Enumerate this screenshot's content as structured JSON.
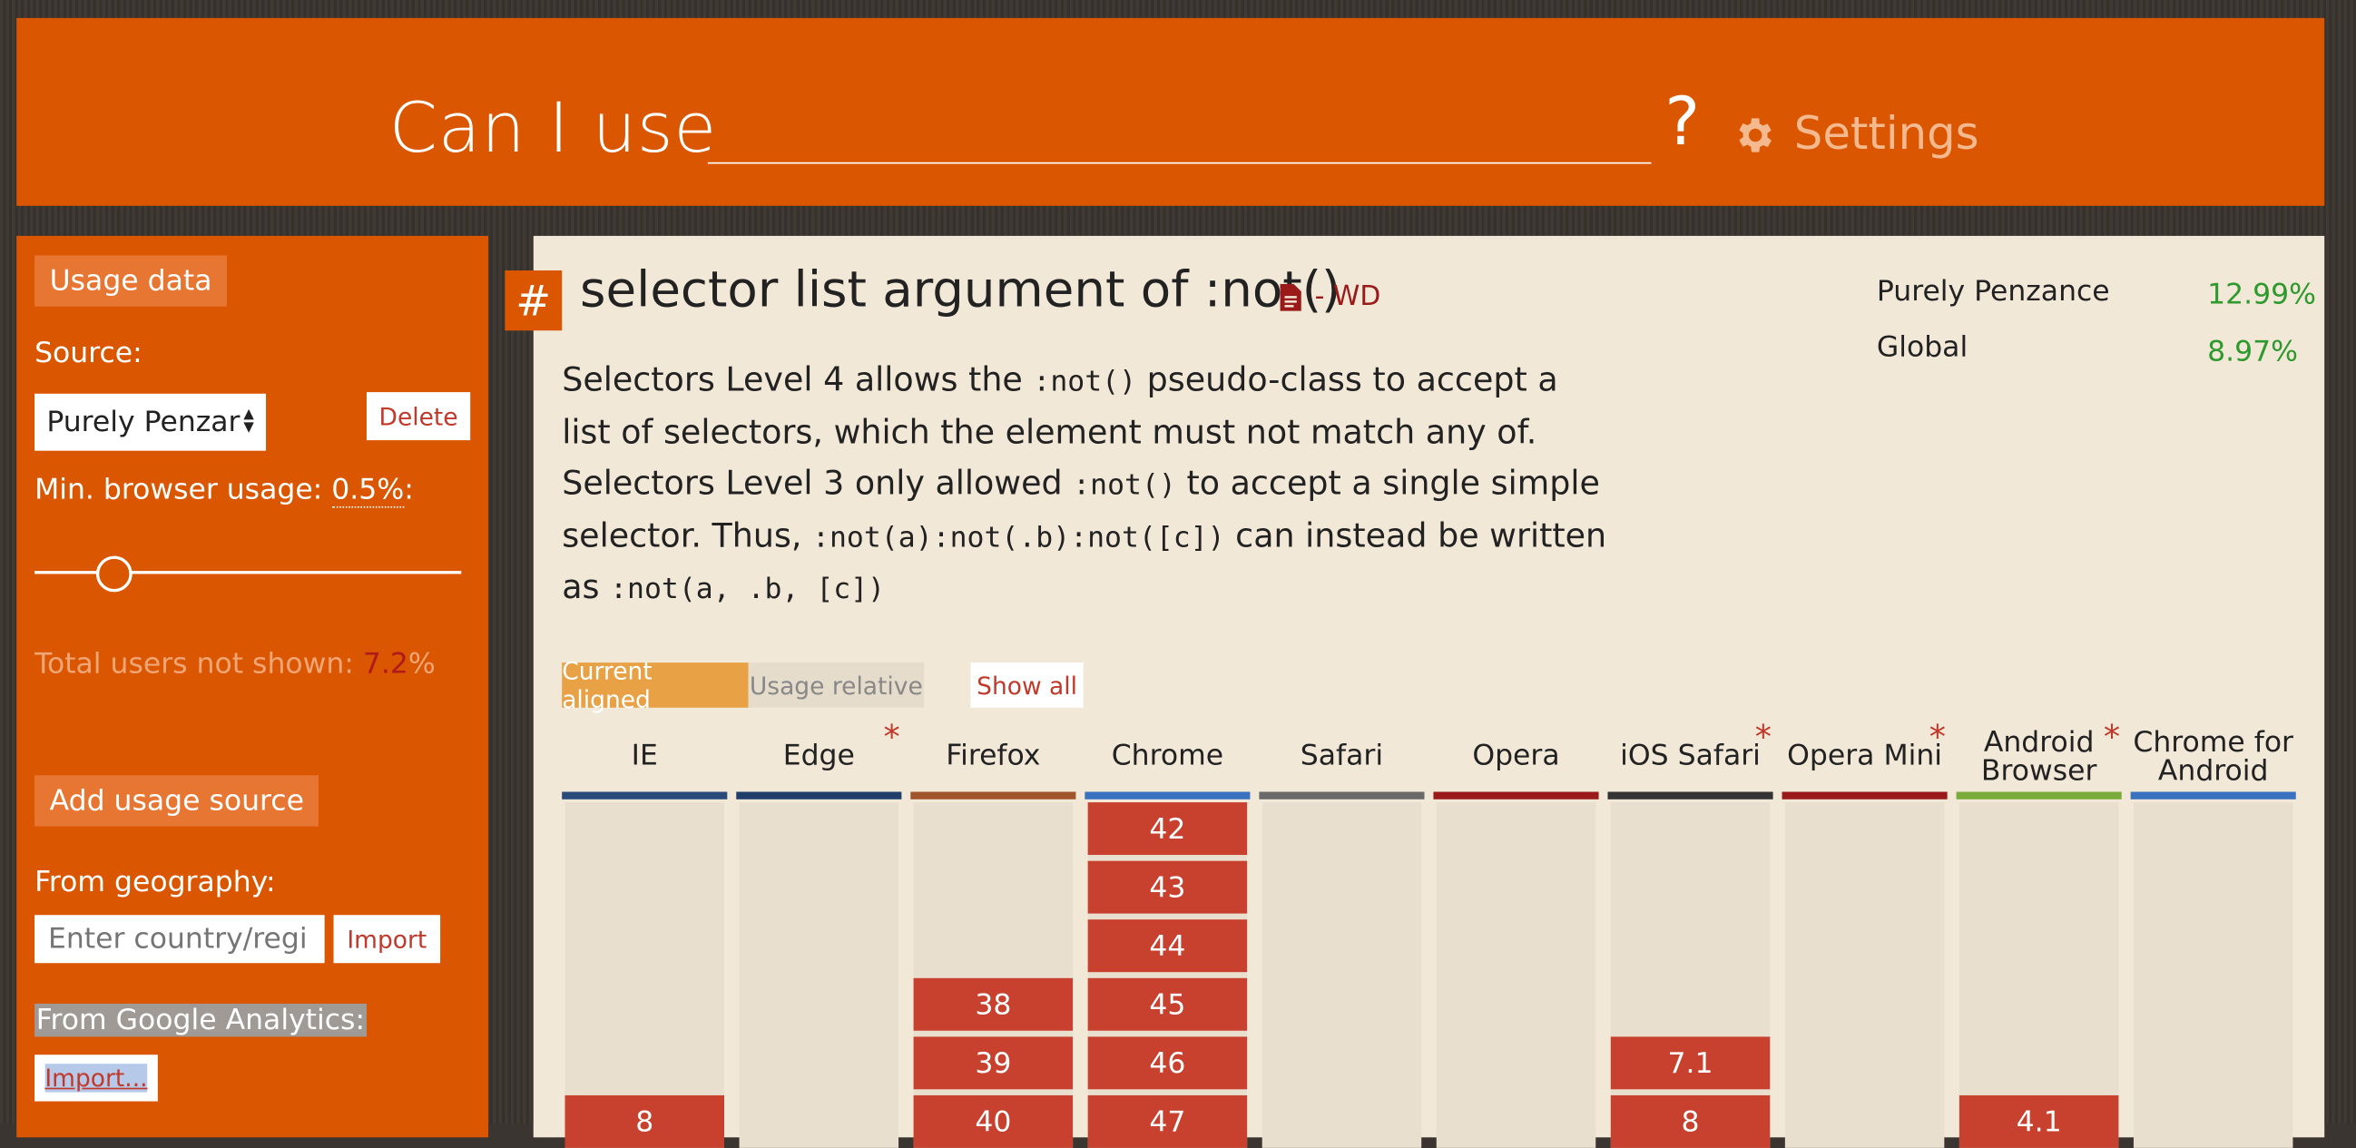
{
  "header": {
    "logo": "Can I use",
    "search_value": "",
    "question_mark": "?",
    "settings_label": "Settings"
  },
  "sidebar": {
    "usage_data_label": "Usage data",
    "source_label": "Source:",
    "source_selected": "Purely Penzar",
    "delete_label": "Delete",
    "min_usage_prefix": "Min. browser usage: ",
    "min_usage_value": "0.5%",
    "min_usage_suffix": ":",
    "slider_value": 0.5,
    "total_not_shown_prefix": "Total users not shown: ",
    "total_not_shown_value": "7.2",
    "total_not_shown_suffix": "%",
    "add_source_label": "Add usage source",
    "from_geography_label": "From geography:",
    "geography_placeholder": "Enter country/regi",
    "import_label": "Import",
    "from_ga_label": "From Google Analytics:",
    "import_ga_label": "Import..."
  },
  "feature": {
    "hash": "#",
    "title": "selector list argument of :not()",
    "status": "- WD",
    "desc": {
      "p1": "Selectors Level 4 allows the ",
      "c1": ":not()",
      "p2": " pseudo-class to accept a list of selectors, which the element must not match any of. Selectors Level 3 only allowed ",
      "c2": ":not()",
      "p3": " to accept a single simple selector. Thus, ",
      "c3": ":not(a):not(.b):not([c])",
      "p4": " can instead be written as ",
      "c4": ":not(a, .b, [c])"
    },
    "stats": [
      {
        "label": "Purely Penzance",
        "value": "12.99%"
      },
      {
        "label": "Global",
        "value": "8.97%"
      }
    ],
    "view_toggle": {
      "current": "Current aligned",
      "relative": "Usage relative",
      "show_all": "Show all"
    }
  },
  "browsers": [
    {
      "name": "IE",
      "color": "#2a4a7a",
      "star": false,
      "versions": [
        "8"
      ]
    },
    {
      "name": "Edge",
      "color": "#1f3f6a",
      "star": true,
      "versions": []
    },
    {
      "name": "Firefox",
      "color": "#a0562a",
      "star": false,
      "versions": [
        "38",
        "39",
        "40"
      ]
    },
    {
      "name": "Chrome",
      "color": "#3a72c0",
      "star": false,
      "versions": [
        "42",
        "43",
        "44",
        "45",
        "46",
        "47"
      ]
    },
    {
      "name": "Safari",
      "color": "#6a6a6a",
      "star": false,
      "versions": []
    },
    {
      "name": "Opera",
      "color": "#9a1a1a",
      "star": false,
      "versions": []
    },
    {
      "name": "iOS Safari",
      "color": "#333333",
      "star": true,
      "versions": [
        "7.1",
        "8"
      ]
    },
    {
      "name": "Opera Mini",
      "color": "#9a1a1a",
      "star": true,
      "versions": []
    },
    {
      "name": "Android Browser",
      "name_l1": "Android",
      "name_l2": "Browser",
      "color": "#7aaa3a",
      "star": true,
      "versions": [
        "4.1"
      ]
    },
    {
      "name": "Chrome for Android",
      "name_l1": "Chrome for",
      "name_l2": "Android",
      "color": "#3a72c0",
      "star": false,
      "versions": []
    }
  ]
}
